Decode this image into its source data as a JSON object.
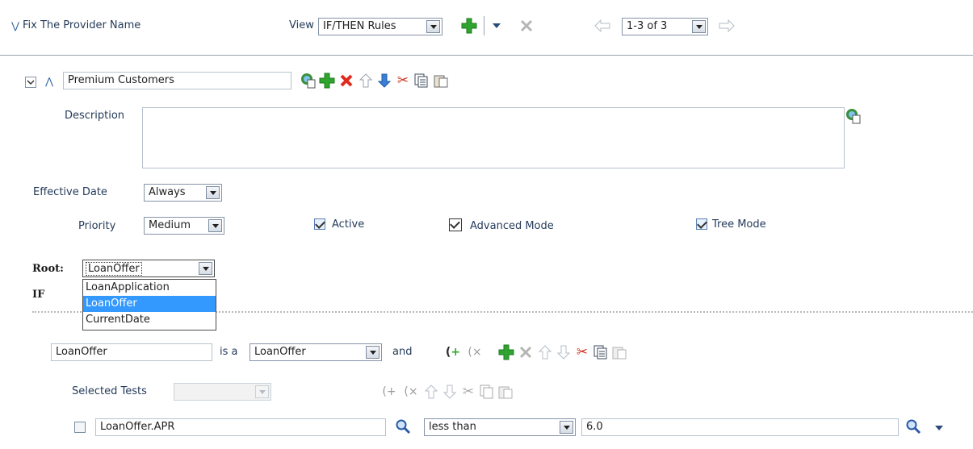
{
  "header": {
    "section_title": "Fix The Provider Name",
    "view_label": "View",
    "view_select": "IF/THEN Rules",
    "pager": "1-3 of 3"
  },
  "rule": {
    "name": "Premium Customers",
    "description_label": "Description",
    "description_value": "",
    "effective_date_label": "Effective Date",
    "effective_date_value": "Always",
    "priority_label": "Priority",
    "priority_value": "Medium",
    "active_label": "Active",
    "advanced_mode_label": "Advanced Mode",
    "tree_mode_label": "Tree Mode"
  },
  "root": {
    "label": "Root:",
    "value": "LoanOffer",
    "options": [
      "LoanApplication",
      "LoanOffer",
      "CurrentDate"
    ],
    "selected_index": 1
  },
  "if_label": "IF",
  "pattern": {
    "variable": "LoanOffer",
    "is_a_label": "is a",
    "type": "LoanOffer",
    "and_label": "and"
  },
  "selected_tests": {
    "label": "Selected Tests",
    "value": ""
  },
  "test": {
    "left": "LoanOffer.APR",
    "operator": "less than",
    "right": "6.0"
  },
  "colors": {
    "plus_green": "#2fa52f",
    "delete_red": "#e02a1e",
    "select_highlight": "#3399ff",
    "divider": "#9aa5b1"
  }
}
